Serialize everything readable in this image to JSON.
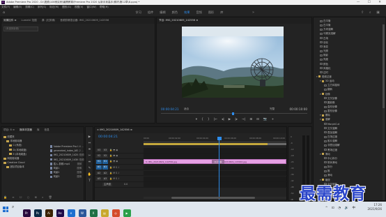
{
  "titlebar": {
    "app_icon": "Pr",
    "title": "Adobe Premiere Pro 2020 - D:\\视频\\108例实例\\最需教育\\Premiere Pro 2020 从新手到高手\\素材\\第12章\\8.pproj *",
    "controls": "—  ☐  ✕"
  },
  "menu": [
    "文件(F)",
    "编辑(E)",
    "剪辑(C)",
    "序列(S)",
    "标记(M)",
    "图形(G)",
    "视图(V)",
    "窗口(W)",
    "帮助(H)"
  ],
  "workspaces": {
    "tabs": [
      "学习",
      "组件",
      "编辑",
      "颜色",
      "效果",
      "音频",
      "图形",
      "库"
    ],
    "active_index": 4,
    "more": "»"
  },
  "source": {
    "tabs": [
      "效果控件 ≡",
      "Lumetri 范围",
      "源: (无剪辑)",
      "音频剪辑混合器: IMG_20210609_142556"
    ],
    "active_index": 0,
    "field": "(未选择剪辑)"
  },
  "program": {
    "tab": "节目: IMG_20210609_142556 ≡",
    "timecode_left": "00:00:04:21",
    "fit": "适合",
    "full": "完整",
    "timecode_right": "00:00:10:00",
    "transport": [
      "▾",
      "{",
      "}",
      "|←",
      "◂|",
      "▶",
      "|▸",
      "→|",
      "⊞",
      "⊟",
      "📷",
      "+"
    ]
  },
  "effects": {
    "rows": [
      {
        "type": "item",
        "label": "白平衡"
      },
      {
        "type": "item",
        "label": "白平衡"
      },
      {
        "type": "item",
        "label": "方块溶解"
      },
      {
        "type": "item",
        "label": "马赛克溶解"
      },
      {
        "type": "item",
        "label": "白场"
      },
      {
        "type": "item",
        "label": "羽化"
      },
      {
        "type": "item",
        "label": "渐变"
      },
      {
        "type": "item",
        "label": "光照"
      },
      {
        "type": "item",
        "label": "阴影"
      },
      {
        "type": "item",
        "label": "亮度"
      },
      {
        "type": "item",
        "label": "颜色"
      },
      {
        "type": "item",
        "label": "风格化"
      },
      {
        "type": "item",
        "label": "过时"
      },
      {
        "type": "group",
        "label": "视频过渡"
      },
      {
        "type": "sub",
        "label": "3D 运动"
      },
      {
        "type": "item2",
        "label": "立方体旋转"
      },
      {
        "type": "item2",
        "label": "翻转"
      },
      {
        "type": "sub",
        "label": "划像"
      },
      {
        "type": "item2",
        "label": "交叉划像"
      },
      {
        "type": "item2",
        "label": "圆划像"
      },
      {
        "type": "item2",
        "label": "盒形划像"
      },
      {
        "type": "item2",
        "label": "菱形划像"
      },
      {
        "type": "sub",
        "label": "擦除"
      },
      {
        "type": "sub",
        "label": "溶解"
      },
      {
        "type": "item2",
        "label": "MorphCut"
      },
      {
        "type": "item2",
        "label": "交叉溶解"
      },
      {
        "type": "item2",
        "label": "叠加溶解"
      },
      {
        "type": "item2",
        "label": "白场过渡"
      },
      {
        "type": "item2",
        "label": "胶片溶解"
      },
      {
        "type": "item2",
        "label": "非叠加溶解"
      },
      {
        "type": "item2",
        "label": "黑场过渡"
      },
      {
        "type": "sub",
        "label": "滑动"
      },
      {
        "type": "item2",
        "label": "中心拆分"
      },
      {
        "type": "item2",
        "label": "带状滑动"
      },
      {
        "type": "item2",
        "label": "拆分"
      },
      {
        "type": "item2",
        "label": "推"
      },
      {
        "type": "item2",
        "label": "滑动"
      },
      {
        "type": "sub",
        "label": "缩放"
      },
      {
        "type": "item2",
        "label": "交叉缩放"
      },
      {
        "type": "sub",
        "label": "页面剥落"
      },
      {
        "type": "item2",
        "label": "翻页"
      },
      {
        "type": "item2",
        "label": "页面剥落"
      }
    ]
  },
  "project": {
    "tabs": [
      "项目: 8 ≡",
      "媒体浏览器",
      "库",
      "信息"
    ],
    "active_index": 1,
    "tree": [
      {
        "label": "收藏夹",
        "indent": 0
      },
      {
        "label": "本地驱动器",
        "indent": 1
      },
      {
        "label": "C:(系统)",
        "indent": 2
      },
      {
        "label": "D:(本地磁盘)",
        "indent": 2
      },
      {
        "label": "E:(本地磁盘)",
        "indent": 2
      },
      {
        "label": "网络驱动器",
        "indent": 0
      },
      {
        "label": "Creative Cloud",
        "indent": 0
      },
      {
        "label": "团队项目版本",
        "indent": 1
      }
    ],
    "files": [
      {
        "name": "Adobe Premiere Pro A",
        "meta": "4.6 ..."
      },
      {
        "name": "generated_index_AE",
        "meta": "1.2 ..."
      },
      {
        "name": "IMG_20210609_142556",
        "meta": "4 视频"
      },
      {
        "name": "IMG_20210609_143002",
        "meta": "4 视频"
      },
      {
        "name": "插入-剪辑.mp4",
        "meta": "视频"
      },
      {
        "name": "风景1",
        "meta": "图像"
      },
      {
        "name": "风景2",
        "meta": "图像"
      },
      {
        "name": "风景3",
        "meta": "图像"
      }
    ],
    "bottom_icons": "🔒 ≡ ☐ ○ ⊞ ⌕ 🗑"
  },
  "tools": [
    "▶",
    "⇔",
    "⇼",
    "✂",
    "⇹",
    "✎",
    "✋",
    "T"
  ],
  "timeline": {
    "tab": "× IMG_20210609_142556 ≡",
    "timecode": "00:00:04:21",
    "ruler": [
      "00:00",
      "00:00:02:00",
      "00:00:04:00",
      "00:00:06:00",
      "00:00:08:00",
      "00:00:10:00"
    ],
    "tracks": [
      {
        "id": "V3",
        "kind": "video"
      },
      {
        "id": "V2",
        "kind": "video"
      },
      {
        "id": "V1",
        "kind": "video",
        "selected": true
      },
      {
        "id": "A1",
        "kind": "audio",
        "selected": true
      },
      {
        "id": "A2",
        "kind": "audio"
      },
      {
        "id": "A3",
        "kind": "audio"
      },
      {
        "id": "主声道",
        "kind": "master",
        "value": "0.0"
      }
    ],
    "clips": [
      {
        "label": "fx IMG_20210609_142556.jpg",
        "track": "V1"
      },
      {
        "label": "fx IMG_20210609_143002.jpg",
        "track": "V1"
      }
    ],
    "transition": "交叉溶解",
    "playhead_time": "00:00:04:21",
    "tracks_visible": 7
  },
  "meters": {
    "scale": [
      "0",
      "-6",
      "-12",
      "-18",
      "-24",
      "-30",
      "-36",
      "-42",
      "-48",
      "-54",
      "dB"
    ]
  },
  "watermark": "最需教育",
  "taskbar": {
    "search_icon": "⌕",
    "apps": [
      {
        "name": "Pr",
        "color": "#2a0a3d"
      },
      {
        "name": "Ps",
        "color": "#0b2a45"
      },
      {
        "name": "Ai",
        "color": "#3a2100"
      },
      {
        "name": "Ae",
        "color": "#1d0a48"
      },
      {
        "name": "e",
        "color": "#1d6fd0"
      },
      {
        "name": "W",
        "color": "#2b579a"
      },
      {
        "name": "X",
        "color": "#1e7145"
      },
      {
        "name": "▤",
        "color": "#c8a82d"
      },
      {
        "name": "◎",
        "color": "#d44a2a"
      },
      {
        "name": "▶",
        "color": "#2aa04a"
      }
    ],
    "tray_icons": "^ ⊡ ◔ 🔊 中",
    "time": "17:26",
    "date": "2021/9/26"
  }
}
